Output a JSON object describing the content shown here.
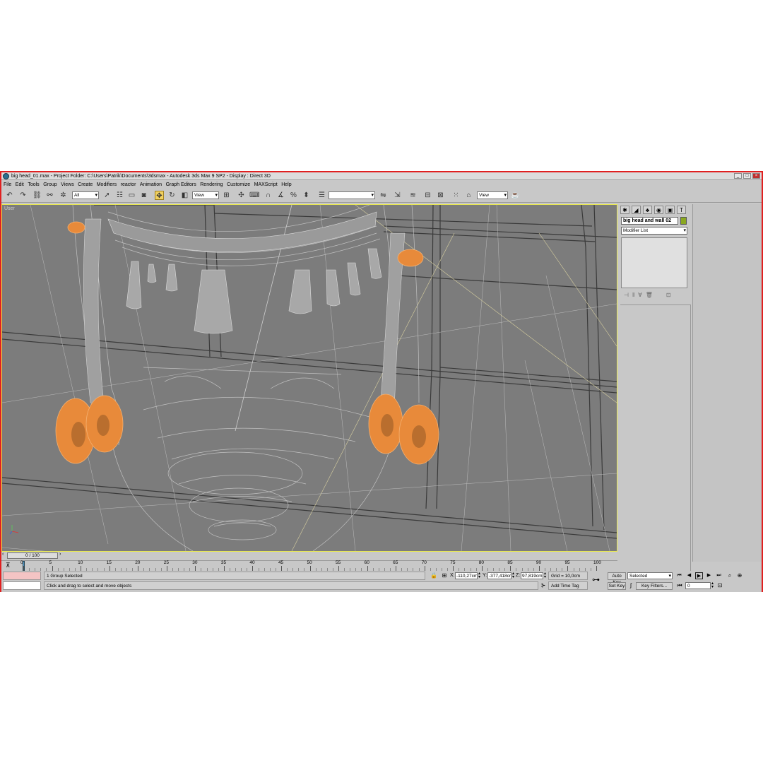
{
  "window": {
    "title": "big head_01.max    - Project Folder: C:\\Users\\Patrik\\Documents\\3dsmax     - Autodesk 3ds Max 9 SP2     - Display : Direct 3D"
  },
  "menu": [
    "File",
    "Edit",
    "Tools",
    "Group",
    "Views",
    "Create",
    "Modifiers",
    "reactor",
    "Animation",
    "Graph Editors",
    "Rendering",
    "Customize",
    "MAXScript",
    "Help"
  ],
  "toolbar": {
    "selection_filter": "All",
    "ref_coord": "View",
    "named_selection": "",
    "render_view": "View"
  },
  "viewport": {
    "label": "User"
  },
  "command_panel": {
    "object_name": "big head and wall 02",
    "object_color": "#8aa820",
    "modifier_list": "Modifier List"
  },
  "time_slider": {
    "label": "0 / 100"
  },
  "timeline": {
    "ticks": [
      "0",
      "5",
      "10",
      "15",
      "20",
      "25",
      "30",
      "35",
      "40",
      "45",
      "50",
      "55",
      "60",
      "65",
      "70",
      "75",
      "80",
      "85",
      "90",
      "95",
      "100"
    ]
  },
  "status": {
    "selection": "1 Group Selected",
    "prompt": "Click and drag to select and move objects",
    "x_label": "X:",
    "x_value": "-110,27cm",
    "y_label": "Y:",
    "y_value": "-377,418cr",
    "z_label": "Z:",
    "z_value": "97,819cm",
    "grid": "Grid = 10,0cm",
    "add_time_tag": "Add Time Tag",
    "auto_key": "Auto Key",
    "set_key": "Set Key",
    "key_mode": "Selected",
    "key_filters": "Key Filters...",
    "current_frame": "0"
  },
  "colors": {
    "selection_highlight": "#f0903a",
    "wireframe": "#c8c8c8",
    "viewport_bg": "#7c7c7c",
    "active_border": "#e8e850"
  }
}
